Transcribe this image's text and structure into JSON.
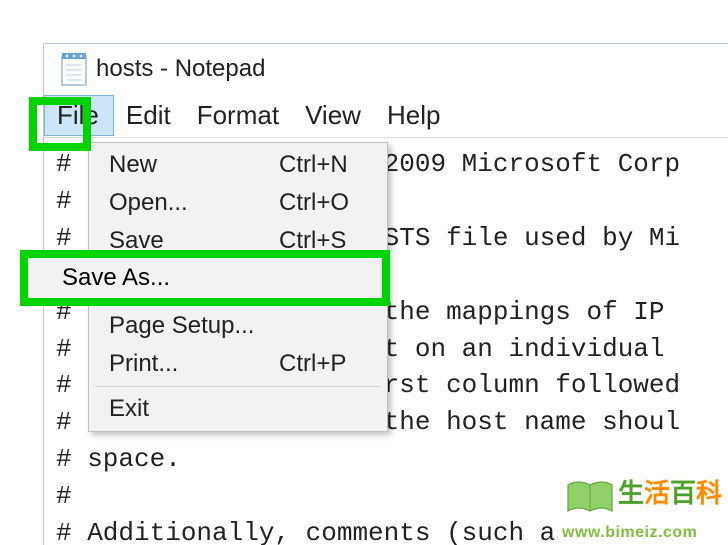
{
  "window": {
    "title": "hosts - Notepad"
  },
  "menubar": {
    "file": "File",
    "edit": "Edit",
    "format": "Format",
    "view": "View",
    "help": "Help"
  },
  "dropdown": {
    "new_label": "New",
    "new_shortcut": "Ctrl+N",
    "open_label": "Open...",
    "open_shortcut": "Ctrl+O",
    "save_label": "Save",
    "save_shortcut": "Ctrl+S",
    "saveas_label": "Save As...",
    "pagesetup_label": "Page Setup...",
    "print_label": "Print...",
    "print_shortcut": "Ctrl+P",
    "exit_label": "Exit"
  },
  "editor": {
    "content": "# Copyright (c) 1993-2009 Microsoft Corp\n#\n# This is a sample HOSTS file used by Mi\n#\n# This file contains the mappings of IP \n# entry should be kept on an individual \n# be placed in the first column followed\n# The IP address and the host name shoul\n# space.\n#\n# Additionally, comments (such as these)"
  },
  "watermark": {
    "brand_cn": "生活百科",
    "url": "www.bimeiz.com"
  }
}
